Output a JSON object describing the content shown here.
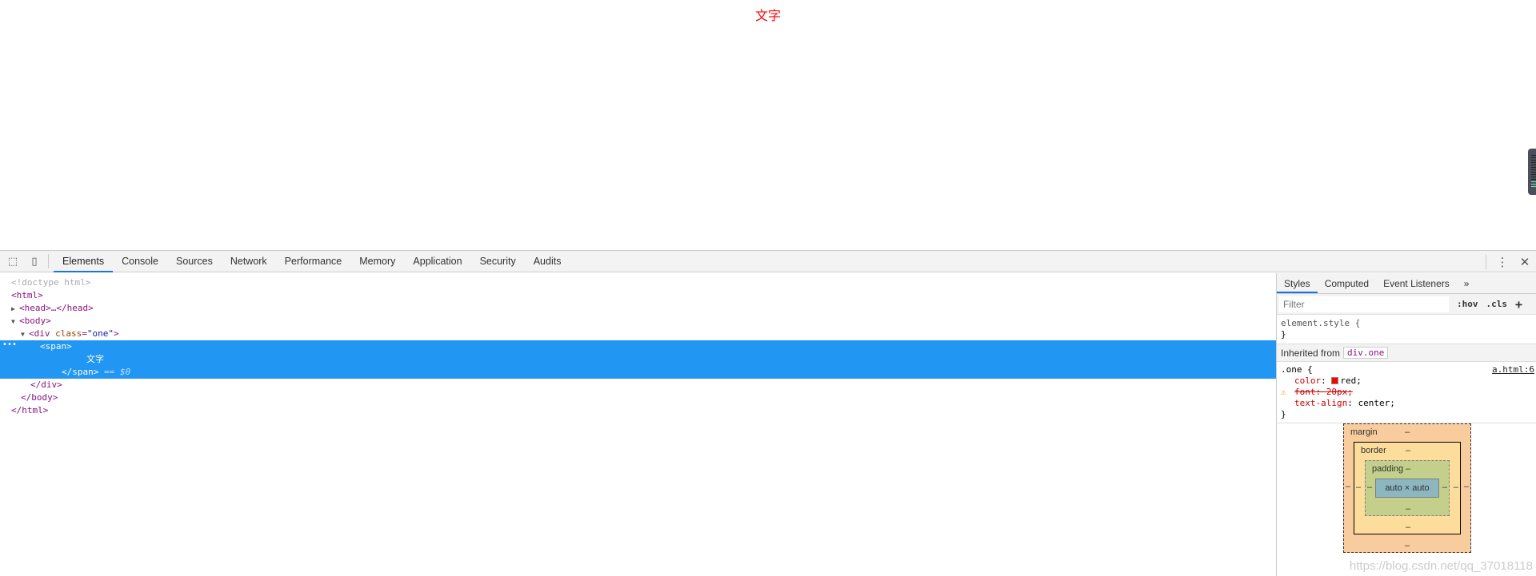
{
  "page": {
    "text": "文字"
  },
  "devtools": {
    "tabs": [
      "Elements",
      "Console",
      "Sources",
      "Network",
      "Performance",
      "Memory",
      "Application",
      "Security",
      "Audits"
    ],
    "active_tab": "Elements",
    "icons": {
      "inspect": "inspect-element-icon",
      "device": "device-toolbar-icon",
      "menu": "more-vert-icon",
      "close": "close-icon"
    },
    "elements": {
      "doctype": "<!doctype html>",
      "html_open": "<html>",
      "head": "<head>…</head>",
      "body_open": "<body>",
      "div_tag": "<div ",
      "div_attr": "class",
      "div_val": "\"one\"",
      "div_close": ">",
      "span_open": "<span>",
      "span_text": "文字",
      "span_close": "</span>",
      "selected_ref": " == $0",
      "div_end": "</div>",
      "body_end": "</body>",
      "html_end": "</html>"
    },
    "styles": {
      "tabs": [
        "Styles",
        "Computed",
        "Event Listeners",
        "»"
      ],
      "filter_placeholder": "Filter",
      "hov": ":hov",
      "cls": ".cls",
      "add": "+",
      "element_style": "element.style {",
      "close_brace": "}",
      "inherited_label": "Inherited from",
      "inherited_tag": "div.one",
      "rule_selector": ".one {",
      "rule_source": "a.html:6",
      "props": [
        {
          "name": "color",
          "value": "red",
          "swatch": "#ff0000"
        },
        {
          "name": "font",
          "value": "20px",
          "invalid": true
        },
        {
          "name": "text-align",
          "value": "center"
        }
      ]
    },
    "box_model": {
      "margin": "margin",
      "border": "border",
      "padding": "padding",
      "content": "auto × auto",
      "dash": "–"
    },
    "watermark": "https://blog.csdn.net/qq_37018118"
  }
}
